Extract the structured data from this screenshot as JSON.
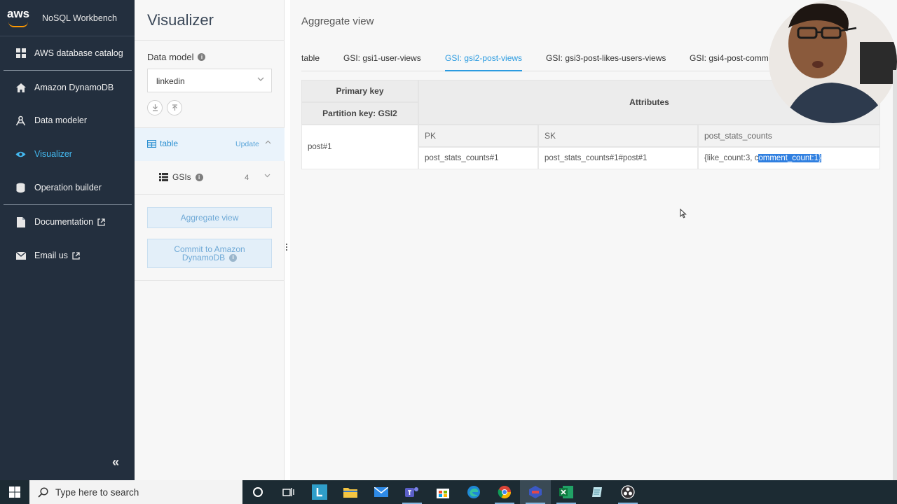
{
  "nav": {
    "brand": "aws",
    "app_name": "NoSQL Workbench",
    "items": [
      {
        "label": "AWS database catalog",
        "icon": "grid-icon"
      },
      {
        "label": "Amazon DynamoDB",
        "icon": "home-icon"
      },
      {
        "label": "Data modeler",
        "icon": "modeler-icon"
      },
      {
        "label": "Visualizer",
        "icon": "eye-icon",
        "active": true
      },
      {
        "label": "Operation builder",
        "icon": "database-icon"
      },
      {
        "label": "Documentation",
        "icon": "document-icon"
      },
      {
        "label": "Email us",
        "icon": "mail-icon"
      }
    ],
    "collapse": "«"
  },
  "visualizer": {
    "title": "Visualizer",
    "data_model_label": "Data model",
    "data_model_value": "linkedin",
    "table_label": "table",
    "update_label": "Update",
    "gsis_label": "GSIs",
    "gsis_count": "4",
    "aggregate_btn": "Aggregate view",
    "commit_line1": "Commit to Amazon",
    "commit_line2": "DynamoDB"
  },
  "main": {
    "title": "Aggregate view",
    "tabs": [
      {
        "label": "table"
      },
      {
        "label": "GSI: gsi1-user-views"
      },
      {
        "label": "GSI: gsi2-post-views",
        "active": true
      },
      {
        "label": "GSI: gsi3-post-likes-users-views"
      },
      {
        "label": "GSI: gsi4-post-comme"
      }
    ],
    "grid": {
      "primary_key": "Primary key",
      "partition_key": "Partition key: GSI2",
      "attributes": "Attributes",
      "col_pk": "PK",
      "col_sk": "SK",
      "col_stats": "post_stats_counts",
      "row_key": "post#1",
      "pk_value": "post_stats_counts#1",
      "sk_value": "post_stats_counts#1#post#1",
      "stats_value_prefix": "{like_count:3, c",
      "stats_value_selected": "omment_count:1}"
    }
  },
  "taskbar": {
    "search_placeholder": "Type here to search"
  },
  "colors": {
    "nav_bg": "#232f3e",
    "accent": "#2b9be0",
    "aws_orange": "#ff9900"
  }
}
